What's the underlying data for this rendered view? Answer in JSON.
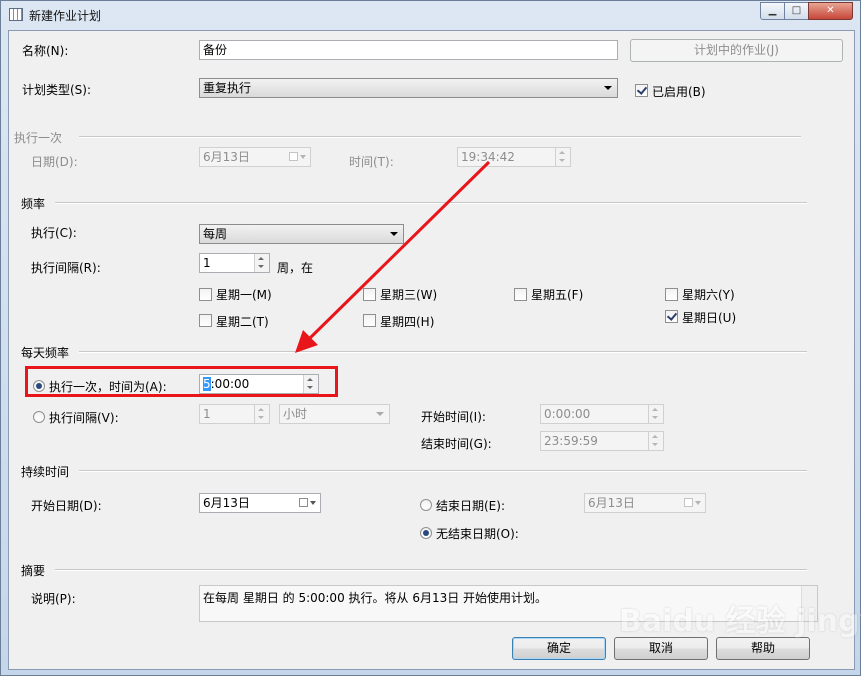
{
  "window": {
    "title": "新建作业计划"
  },
  "general": {
    "name_label": "名称(N):",
    "name_value": "备份",
    "jobs_button": "计划中的作业(J)",
    "schedule_type_label": "计划类型(S):",
    "schedule_type_value": "重复执行",
    "enabled_label": "已启用(B)",
    "enabled_checked": true
  },
  "run_once": {
    "section_title": "执行一次",
    "date_label": "日期(D):",
    "date_value": "6月13日",
    "time_label": "时间(T):",
    "time_value": "19:34:42"
  },
  "frequency": {
    "section_title": "频率",
    "occurs_label": "执行(C):",
    "occurs_value": "每周",
    "interval_label": "执行间隔(R):",
    "interval_value": "1",
    "interval_unit": "周，在",
    "days": [
      {
        "label": "星期一(M)",
        "checked": false
      },
      {
        "label": "星期二(T)",
        "checked": false
      },
      {
        "label": "星期三(W)",
        "checked": false
      },
      {
        "label": "星期四(H)",
        "checked": false
      },
      {
        "label": "星期五(F)",
        "checked": false
      },
      {
        "label": "星期六(Y)",
        "checked": false
      },
      {
        "label": "星期日(U)",
        "checked": true
      }
    ]
  },
  "daily": {
    "section_title": "每天频率",
    "once_label": "执行一次，时间为(A):",
    "once_time_selected": "5",
    "once_time_rest": ":00:00",
    "interval_label": "执行间隔(V):",
    "interval_value": "1",
    "interval_unit": "小时",
    "start_time_label": "开始时间(I):",
    "start_time_value": "0:00:00",
    "end_time_label": "结束时间(G):",
    "end_time_value": "23:59:59"
  },
  "duration": {
    "section_title": "持续时间",
    "start_date_label": "开始日期(D):",
    "start_date_value": "6月13日",
    "end_date_label": "结束日期(E):",
    "end_date_value": "6月13日",
    "no_end_label": "无结束日期(O):"
  },
  "summary": {
    "section_title": "摘要",
    "description_label": "说明(P):",
    "description_value": "在每周 星期日 的 5:00:00 执行。将从 6月13日 开始使用计划。"
  },
  "buttons": {
    "ok": "确定",
    "cancel": "取消",
    "help": "帮助"
  },
  "annotation": {
    "highlight_color": "#e8151b",
    "arrow_color": "#e8151b"
  },
  "watermark": "Baidu 经验 jingyan.baidu.com"
}
